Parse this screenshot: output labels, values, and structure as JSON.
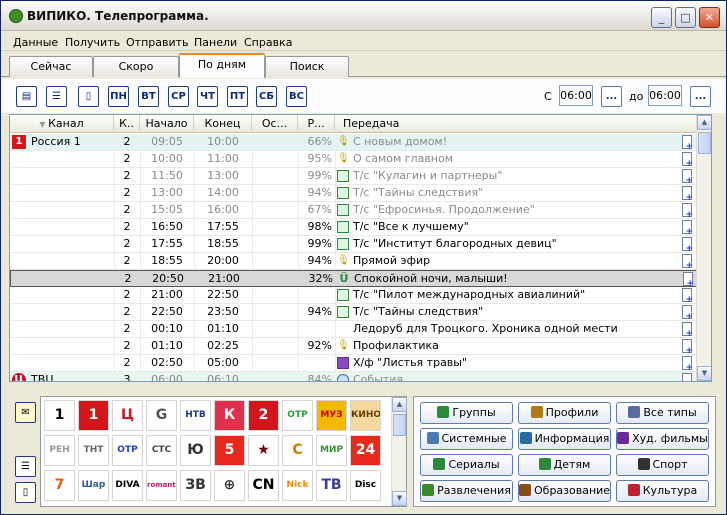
{
  "window": {
    "title": "ВИПИКО. Телепрограмма."
  },
  "menu": [
    "Данные",
    "Получить",
    "Отправить",
    "Панели",
    "Справка"
  ],
  "tabs": [
    "Сейчас",
    "Скоро",
    "По дням",
    "Поиск"
  ],
  "toolbar": {
    "days": [
      "ПН",
      "ВТ",
      "СР",
      "ЧТ",
      "ПТ",
      "СБ",
      "ВС"
    ],
    "from_label": "С",
    "from_value": "06:00",
    "to_label": "до",
    "to_value": "06:00",
    "ellipsis": "..."
  },
  "columns": [
    "Канал",
    "К..",
    "Начало",
    "Конец",
    "Ос...",
    "Р...",
    "Передача"
  ],
  "rows": [
    {
      "channel": "Россия 1",
      "k": "2",
      "start": "09:05",
      "end": "10:00",
      "rating": "66%",
      "icon": "mic",
      "title": "С новым домом!",
      "past": true
    },
    {
      "channel": "",
      "k": "2",
      "start": "10:00",
      "end": "11:00",
      "rating": "95%",
      "icon": "mic",
      "title": "О самом главном",
      "past": true
    },
    {
      "channel": "",
      "k": "2",
      "start": "11:50",
      "end": "13:00",
      "rating": "99%",
      "icon": "tv",
      "title": "Т/с \"Кулагин и партнеры\"",
      "past": true
    },
    {
      "channel": "",
      "k": "2",
      "start": "13:00",
      "end": "14:00",
      "rating": "94%",
      "icon": "tv",
      "title": "Т/с \"Тайны следствия\"",
      "past": true
    },
    {
      "channel": "",
      "k": "2",
      "start": "15:05",
      "end": "16:00",
      "rating": "67%",
      "icon": "tv",
      "title": "Т/с \"Ефросинья. Продолжение\"",
      "past": true
    },
    {
      "channel": "",
      "k": "2",
      "start": "16:50",
      "end": "17:55",
      "rating": "98%",
      "icon": "tv",
      "title": "Т/с \"Все к лучшему\"",
      "past": false
    },
    {
      "channel": "",
      "k": "2",
      "start": "17:55",
      "end": "18:55",
      "rating": "99%",
      "icon": "tv",
      "title": "Т/с \"Институт благородных девиц\"",
      "past": false
    },
    {
      "channel": "",
      "k": "2",
      "start": "18:55",
      "end": "20:00",
      "rating": "94%",
      "icon": "mic",
      "title": "Прямой эфир",
      "past": false
    },
    {
      "channel": "",
      "k": "2",
      "start": "20:50",
      "end": "21:00",
      "rating": "32%",
      "icon": "baby",
      "title": "Спокойной ночи, малыши!",
      "past": false,
      "selected": true
    },
    {
      "channel": "",
      "k": "2",
      "start": "21:00",
      "end": "22:50",
      "rating": "",
      "icon": "tv",
      "title": "Т/с \"Пилот международных авиалиний\"",
      "past": false
    },
    {
      "channel": "",
      "k": "2",
      "start": "22:50",
      "end": "23:50",
      "rating": "94%",
      "icon": "tv",
      "title": "Т/с \"Тайны следствия\"",
      "past": false
    },
    {
      "channel": "",
      "k": "2",
      "start": "00:10",
      "end": "01:10",
      "rating": "",
      "icon": "",
      "title": "Ледоруб для Троцкого. Хроника одной мести",
      "past": false
    },
    {
      "channel": "",
      "k": "2",
      "start": "01:10",
      "end": "02:25",
      "rating": "92%",
      "icon": "mic",
      "title": "Профилактика",
      "past": false
    },
    {
      "channel": "",
      "k": "2",
      "start": "02:50",
      "end": "05:00",
      "rating": "",
      "icon": "film",
      "title": "Х/ф \"Листья травы\"",
      "past": false
    },
    {
      "channel": "ТВЦ",
      "k": "3",
      "start": "06:00",
      "end": "06:10",
      "rating": "84%",
      "icon": "globe",
      "title": "События",
      "past": true
    }
  ],
  "channels": [
    [
      "1",
      "1",
      "Ц",
      "G",
      "НТВ",
      "К",
      "2",
      "ОТР",
      "МУЗ",
      "КИНО"
    ],
    [
      "РЕН",
      "ТНТ",
      "ОТР",
      "СТС",
      "Ю",
      "5",
      "★",
      "С",
      "МИР",
      "24"
    ],
    [
      "7",
      "Шар",
      "DIVA",
      "romantica",
      "ЗВ",
      "⊕",
      "CN",
      "Nick",
      "ТВ",
      "Disc"
    ]
  ],
  "categories": [
    "Группы",
    "Профили",
    "Все типы",
    "Системные",
    "Информация",
    "Худ. фильмы",
    "Сериалы",
    "Детям",
    "Спорт",
    "Развлечения",
    "Образование",
    "Культура"
  ],
  "colors": {
    "accent": "#e68b2c",
    "selection": "#d7d7d7",
    "current": "#e4f4f4"
  }
}
